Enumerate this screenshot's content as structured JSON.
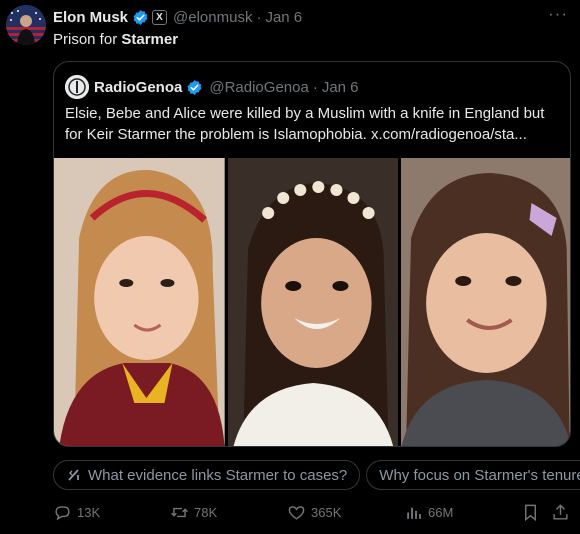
{
  "post": {
    "author_name": "Elon Musk",
    "handle": "@elonmusk",
    "separator": "·",
    "date": "Jan 6",
    "more": "···",
    "text_prefix": "Prison for ",
    "text_bold": "Starmer"
  },
  "quote": {
    "author_name": "RadioGenoa",
    "handle": "@RadioGenoa",
    "separator": "·",
    "date": "Jan 6",
    "text": "Elsie, Bebe and Alice were killed by a Muslim with a knife in England but for Keir Starmer the problem is Islamophobia.  x.com/radiogenoa/sta..."
  },
  "chips": [
    {
      "label": "What evidence links Starmer to cases?"
    },
    {
      "label": "Why focus on Starmer's tenure"
    }
  ],
  "actions": {
    "replies": "13K",
    "reposts": "78K",
    "likes": "365K",
    "views": "66M"
  },
  "colors": {
    "background": "#000000",
    "text": "#e7e9ea",
    "muted": "#71767b",
    "verified": "#1d9bf0",
    "border": "#333639"
  }
}
